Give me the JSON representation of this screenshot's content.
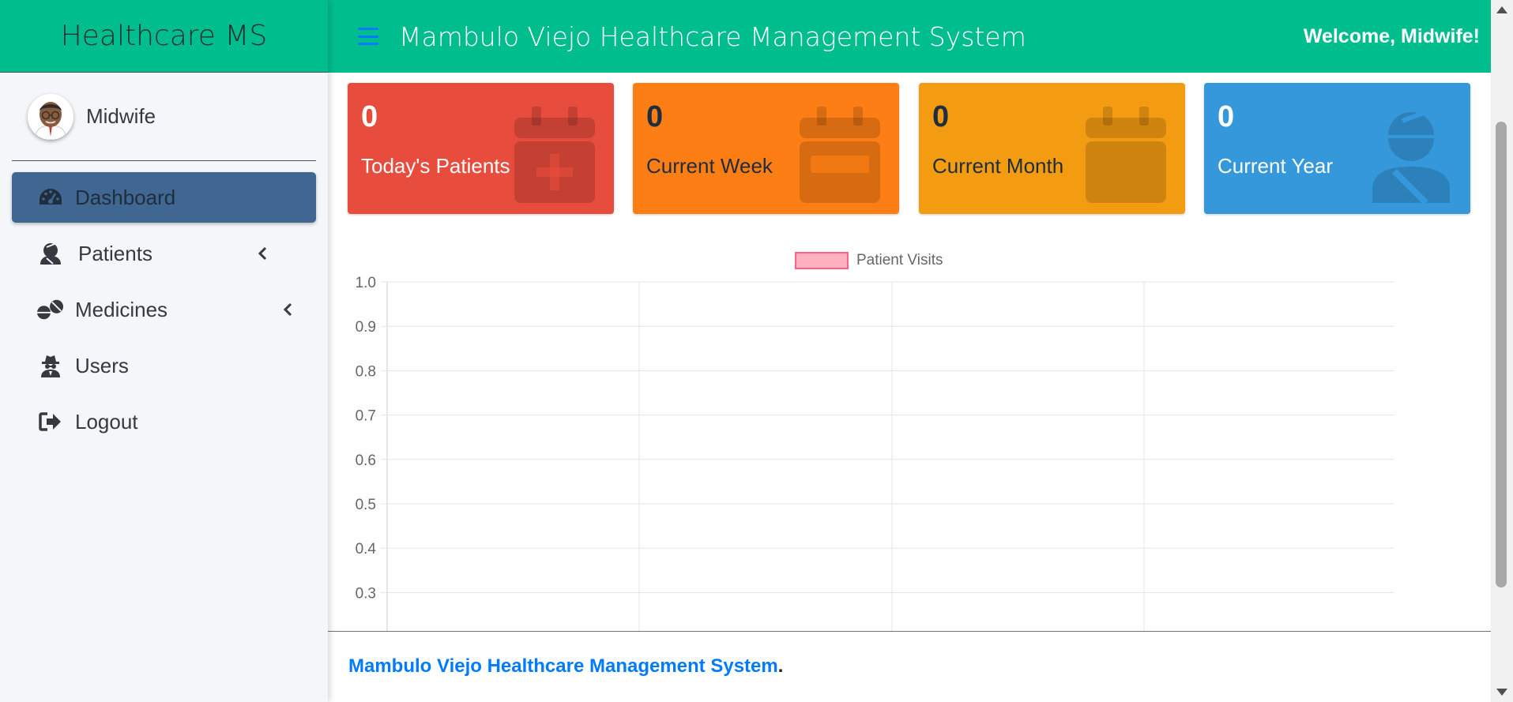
{
  "sidebar": {
    "brand": "Healthcare MS",
    "user_name": "Midwife",
    "items": [
      {
        "label": "Dashboard",
        "icon": "tachometer-icon",
        "active": true
      },
      {
        "label": "Patients",
        "icon": "user-injured-icon",
        "has_submenu": true
      },
      {
        "label": "Medicines",
        "icon": "pills-icon",
        "has_submenu": true
      },
      {
        "label": "Users",
        "icon": "user-secret-icon"
      },
      {
        "label": "Logout",
        "icon": "sign-out-icon"
      }
    ]
  },
  "header": {
    "title": "Mambulo Viejo Healthcare Management System",
    "welcome": "Welcome, Midwife!",
    "colors": {
      "bar": "#00bd8e",
      "menu_icon": "#007bff"
    }
  },
  "stats": [
    {
      "value": "0",
      "label": "Today's Patients",
      "color": "#e74c3c",
      "icon": "calendar-plus-icon"
    },
    {
      "value": "0",
      "label": "Current Week",
      "color": "#fd7e14",
      "icon": "calendar-week-icon"
    },
    {
      "value": "0",
      "label": "Current Month",
      "color": "#f39c12",
      "icon": "calendar-icon"
    },
    {
      "value": "0",
      "label": "Current Year",
      "color": "#3498db",
      "icon": "user-injured-icon"
    }
  ],
  "chart_data": {
    "type": "line",
    "series": [
      {
        "name": "Patient Visits",
        "values": []
      }
    ],
    "y_ticks": [
      "1.0",
      "0.9",
      "0.8",
      "0.7",
      "0.6",
      "0.5",
      "0.4",
      "0.3"
    ],
    "ylim": [
      0.3,
      1.0
    ],
    "grid": true,
    "legend": "top-center",
    "legend_color": "#ffb1c1",
    "legend_border": "#ff6384"
  },
  "footer": {
    "link_text": "Mambulo Viejo Healthcare Management System",
    "suffix": "."
  }
}
